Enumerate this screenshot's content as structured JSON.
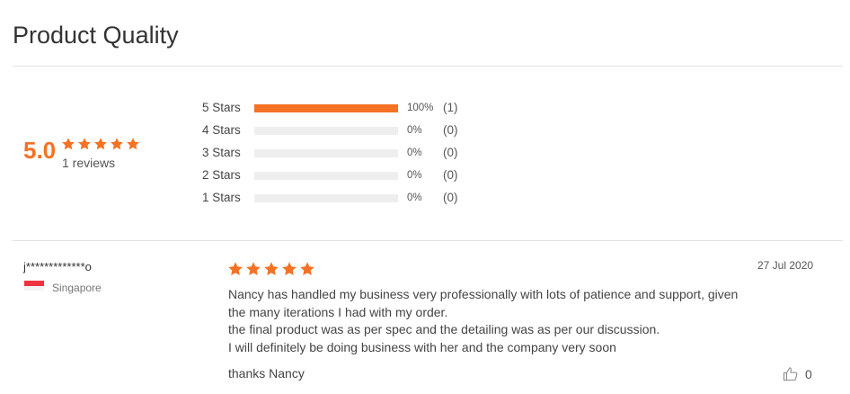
{
  "section": {
    "title": "Product Quality"
  },
  "summary": {
    "average": "5.0",
    "average_stars": 5,
    "review_count": "1 reviews"
  },
  "distribution": [
    {
      "label": "5 Stars",
      "percent": "100%",
      "count": "(1)",
      "fraction": 1.0
    },
    {
      "label": "4 Stars",
      "percent": "0%",
      "count": "(0)",
      "fraction": 0
    },
    {
      "label": "3 Stars",
      "percent": "0%",
      "count": "(0)",
      "fraction": 0
    },
    {
      "label": "2 Stars",
      "percent": "0%",
      "count": "(0)",
      "fraction": 0
    },
    {
      "label": "1 Stars",
      "percent": "0%",
      "count": "(0)",
      "fraction": 0
    }
  ],
  "review": {
    "author": "j*************o",
    "country": "Singapore",
    "date": "27 Jul 2020",
    "rating": 5,
    "lines": [
      "Nancy has handled my business very professionally with lots of patience and support, given",
      "the many iterations I had with my order.",
      "the final product was as per spec and the detailing was as per our discussion.",
      "I will definitely be doing business with her and the company very soon"
    ],
    "closing": "thanks Nancy",
    "likes": "0"
  },
  "colors": {
    "accent": "#f57224",
    "bar_bg": "#eeeeee",
    "divider": "#e3e3e3"
  },
  "icons": {
    "star": "star-icon",
    "flag": "singapore-flag-icon",
    "like": "thumbs-up-icon"
  }
}
